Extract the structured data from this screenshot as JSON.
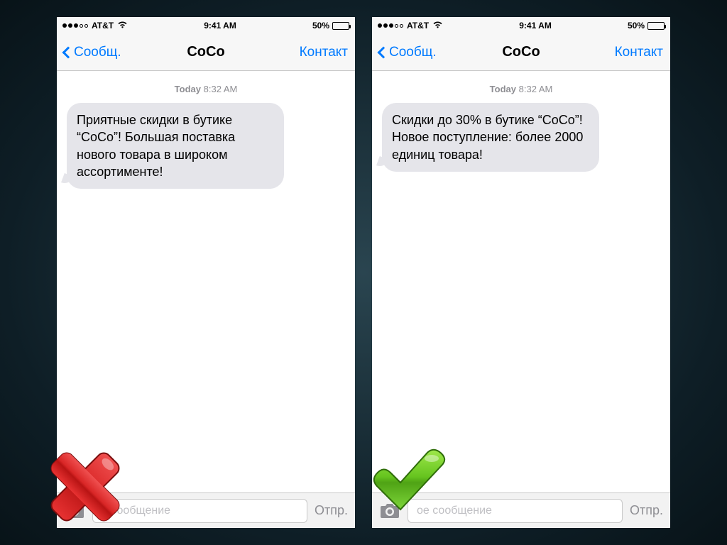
{
  "status": {
    "carrier": "AT&T",
    "time": "9:41 AM",
    "battery_pct": "50%"
  },
  "nav": {
    "back": "Сообщ.",
    "title": "CoCo",
    "action": "Контакт"
  },
  "timestamp": {
    "day": "Today",
    "time": "8:32 AM"
  },
  "messages": {
    "bad": "Приятные скидки в бутике “CoCo”! Большая поставка нового товара в широком ассортименте!",
    "good": "Скидки до 30% в бутике “CoCo”! Новое поступление: более 2000 единиц товара!"
  },
  "compose": {
    "placeholder_full": "Текстовое сообщение",
    "placeholder_cut_bad": "е сообщение",
    "placeholder_cut_good": "ое сообщение",
    "send": "Отпр."
  }
}
